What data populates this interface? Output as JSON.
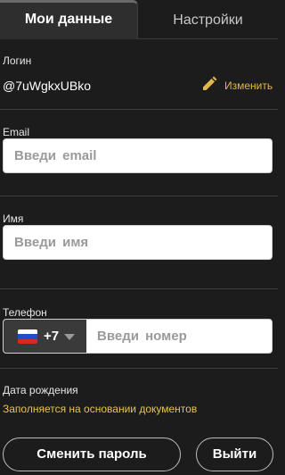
{
  "tabs": [
    {
      "label": "Мои данные",
      "active": true
    },
    {
      "label": "Настройки",
      "active": false
    }
  ],
  "login": {
    "label": "Логин",
    "value": "@7uWgkxUBko",
    "edit_label": "Изменить",
    "edit_icon": "pencil-icon"
  },
  "email": {
    "label": "Email",
    "placeholder": "Введи  email",
    "value": ""
  },
  "name": {
    "label": "Имя",
    "placeholder": "Введи  имя",
    "value": ""
  },
  "phone": {
    "label": "Телефон",
    "country_flag": "russia-flag",
    "code": "+7",
    "placeholder": "Введи  номер",
    "value": ""
  },
  "birth": {
    "label": "Дата рождения",
    "note": "Заполняется на основании документов"
  },
  "actions": {
    "change_password": "Сменить пароль",
    "logout": "Выйти"
  },
  "colors": {
    "background": "#1c1c1c",
    "accent": "#e0b84a",
    "tab_active_bg": "#2e2e2e"
  }
}
